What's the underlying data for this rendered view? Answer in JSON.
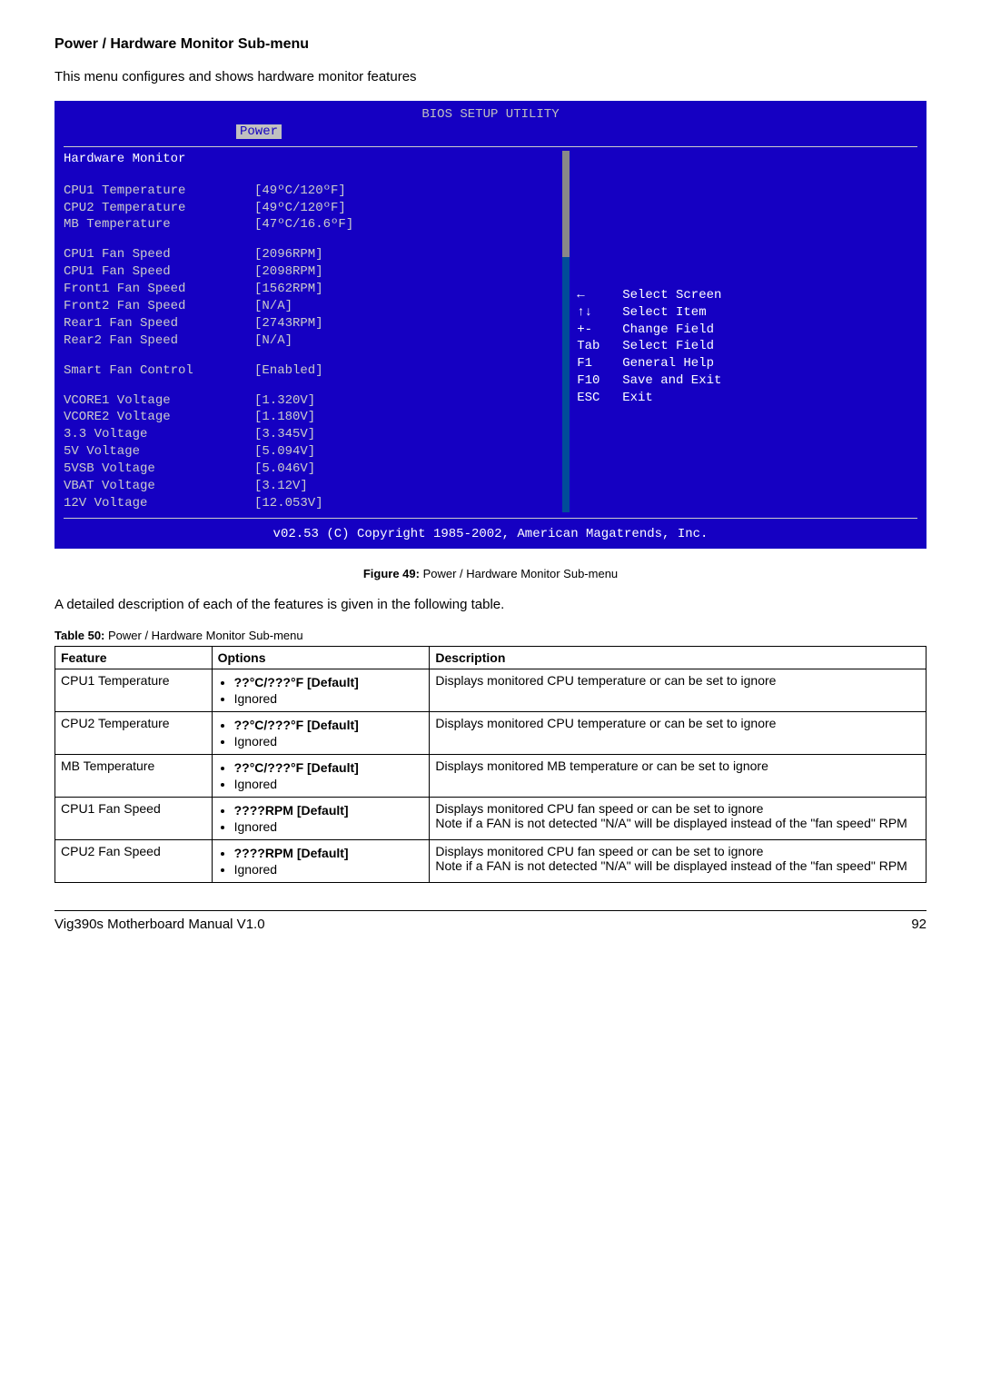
{
  "heading": "Power / Hardware Monitor Sub-menu",
  "intro": "This menu configures and shows hardware monitor features",
  "bios": {
    "title": "BIOS SETUP UTILITY",
    "tab": "Power",
    "section": "Hardware Monitor",
    "rows1": [
      {
        "label": "CPU1 Temperature",
        "value": "[49ºC/120ºF]"
      },
      {
        "label": "CPU2 Temperature",
        "value": "[49ºC/120ºF]"
      },
      {
        "label": "MB Temperature",
        "value": "[47ºC/16.6ºF]"
      }
    ],
    "rows2": [
      {
        "label": "CPU1 Fan Speed",
        "value": "[2096RPM]"
      },
      {
        "label": "CPU1 Fan Speed",
        "value": "[2098RPM]"
      },
      {
        "label": "Front1 Fan Speed",
        "value": "[1562RPM]"
      },
      {
        "label": "Front2 Fan Speed",
        "value": "[N/A]"
      },
      {
        "label": "Rear1 Fan Speed",
        "value": "[2743RPM]"
      },
      {
        "label": "Rear2 Fan Speed",
        "value": "[N/A]"
      }
    ],
    "smart": {
      "label": "Smart Fan Control",
      "value": "[Enabled]"
    },
    "rows3": [
      {
        "label": "VCORE1 Voltage",
        "value": "[1.320V]"
      },
      {
        "label": "VCORE2 Voltage",
        "value": "[1.180V]"
      },
      {
        "label": "3.3 Voltage",
        "value": "[3.345V]"
      },
      {
        "label": "5V Voltage",
        "value": "[5.094V]"
      },
      {
        "label": "5VSB Voltage",
        "value": "[5.046V]"
      },
      {
        "label": "VBAT Voltage",
        "value": "[3.12V]"
      },
      {
        "label": "12V Voltage",
        "value": "[12.053V]"
      }
    ],
    "help": [
      {
        "key": "←",
        "text": "Select Screen"
      },
      {
        "key": "↑↓",
        "text": "Select Item"
      },
      {
        "key": "+-",
        "text": "Change Field"
      },
      {
        "key": "Tab",
        "text": "Select Field"
      },
      {
        "key": "F1",
        "text": "General Help"
      },
      {
        "key": "F10",
        "text": "Save and Exit"
      },
      {
        "key": "ESC",
        "text": "Exit"
      }
    ],
    "footer": "v02.53 (C) Copyright 1985-2002, American Magatrends, Inc."
  },
  "figcaption_bold": "Figure 49:",
  "figcaption_text": " Power / Hardware Monitor Sub-menu",
  "mid_para": "A detailed description of each of the features is given in the following table.",
  "tblcaption_bold": "Table 50:",
  "tblcaption_text": " Power / Hardware Monitor Sub-menu",
  "th": {
    "feature": "Feature",
    "options": "Options",
    "description": "Description"
  },
  "rows": [
    {
      "feature": "CPU1 Temperature",
      "opt1": "??°C/???°F [Default]",
      "opt2": "Ignored",
      "desc": "Displays monitored CPU temperature or can be set to ignore"
    },
    {
      "feature": "CPU2 Temperature",
      "opt1": "??°C/???°F [Default]",
      "opt2": "Ignored",
      "desc": "Displays monitored CPU temperature or can be set to ignore"
    },
    {
      "feature": "MB Temperature",
      "opt1": "??°C/???°F [Default]",
      "opt2": "Ignored",
      "desc": "Displays monitored MB temperature or can be set to ignore"
    },
    {
      "feature": "CPU1 Fan Speed",
      "opt1": "????RPM [Default]",
      "opt2": "Ignored",
      "desc": "Displays monitored CPU fan speed or can be set to ignore",
      "desc2": "Note if a FAN is not detected \"N/A\" will be displayed instead of the \"fan speed\" RPM"
    },
    {
      "feature": "CPU2 Fan Speed",
      "opt1": "????RPM [Default]",
      "opt2": "Ignored",
      "desc": "Displays monitored CPU fan speed or can be set to ignore",
      "desc2": "Note if a FAN is not detected \"N/A\" will be displayed instead of the \"fan speed\" RPM"
    }
  ],
  "footer_left": "Vig390s Motherboard Manual V1.0",
  "footer_right": "92"
}
